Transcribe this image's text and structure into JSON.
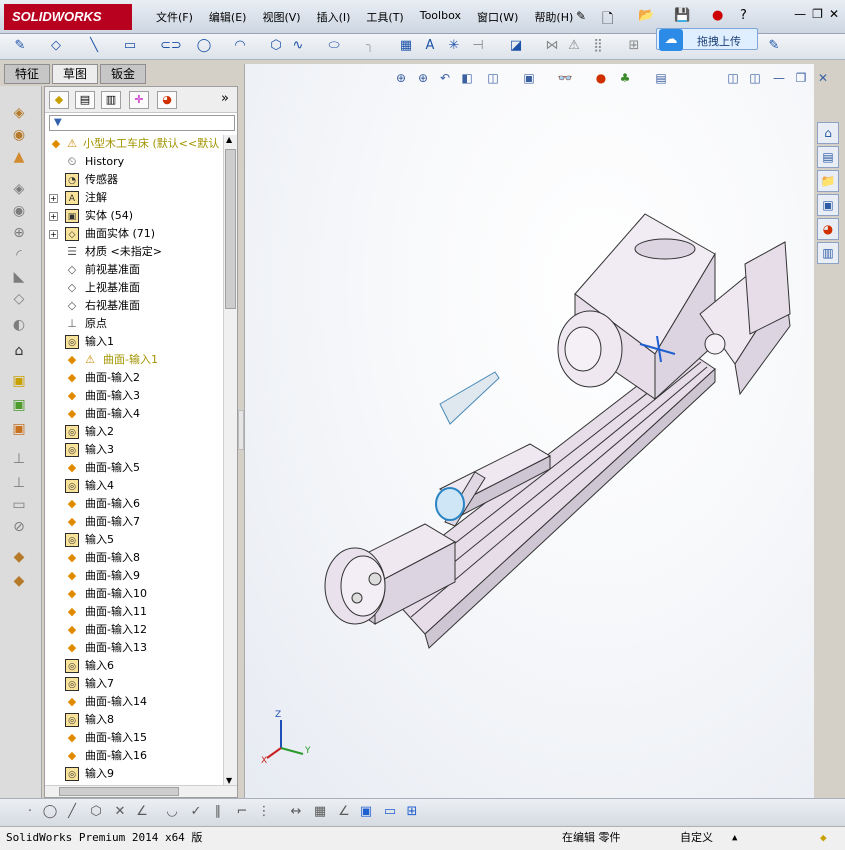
{
  "app": {
    "logo_text": "SOLIDWORKS",
    "menus": [
      "文件(F)",
      "编辑(E)",
      "视图(V)",
      "插入(I)",
      "工具(T)",
      "Toolbox",
      "窗口(W)",
      "帮助(H)"
    ],
    "window_controls": [
      "—",
      "❐",
      "✕"
    ]
  },
  "upload_tip": {
    "label": "拖拽上传"
  },
  "tabs": [
    "特征",
    "草图",
    "钣金"
  ],
  "active_tab": "草图",
  "tree": {
    "items": [
      {
        "label": "小型木工车床  (默认<<默认",
        "type": "root",
        "warning": true
      },
      {
        "label": "History",
        "type": "history"
      },
      {
        "label": "传感器",
        "type": "sensor"
      },
      {
        "label": "注解",
        "type": "annotation",
        "expandable": true
      },
      {
        "label": "实体 (54)",
        "type": "solid",
        "expandable": true
      },
      {
        "label": "曲面实体 (71)",
        "type": "surface-body",
        "expandable": true
      },
      {
        "label": "材质 <未指定>",
        "type": "material"
      },
      {
        "label": "前视基准面",
        "type": "plane"
      },
      {
        "label": "上视基准面",
        "type": "plane"
      },
      {
        "label": "右视基准面",
        "type": "plane"
      },
      {
        "label": "原点",
        "type": "origin"
      },
      {
        "label": "输入1",
        "type": "import"
      },
      {
        "label": "曲面-输入1",
        "type": "surface",
        "warning": true
      },
      {
        "label": "曲面-输入2",
        "type": "surface"
      },
      {
        "label": "曲面-输入3",
        "type": "surface"
      },
      {
        "label": "曲面-输入4",
        "type": "surface"
      },
      {
        "label": "输入2",
        "type": "import"
      },
      {
        "label": "输入3",
        "type": "import"
      },
      {
        "label": "曲面-输入5",
        "type": "surface"
      },
      {
        "label": "输入4",
        "type": "import"
      },
      {
        "label": "曲面-输入6",
        "type": "surface"
      },
      {
        "label": "曲面-输入7",
        "type": "surface"
      },
      {
        "label": "输入5",
        "type": "import"
      },
      {
        "label": "曲面-输入8",
        "type": "surface"
      },
      {
        "label": "曲面-输入9",
        "type": "surface"
      },
      {
        "label": "曲面-输入10",
        "type": "surface"
      },
      {
        "label": "曲面-输入11",
        "type": "surface"
      },
      {
        "label": "曲面-输入12",
        "type": "surface"
      },
      {
        "label": "曲面-输入13",
        "type": "surface"
      },
      {
        "label": "输入6",
        "type": "import"
      },
      {
        "label": "输入7",
        "type": "import"
      },
      {
        "label": "曲面-输入14",
        "type": "surface"
      },
      {
        "label": "输入8",
        "type": "import"
      },
      {
        "label": "曲面-输入15",
        "type": "surface"
      },
      {
        "label": "曲面-输入16",
        "type": "surface"
      },
      {
        "label": "输入9",
        "type": "import"
      }
    ]
  },
  "status": {
    "version": "SolidWorks Premium 2014 x64 版",
    "edit_mode": "在编辑 零件",
    "units": "自定义"
  },
  "colors": {
    "logo_red": "#b8001f",
    "accent_blue": "#2b8be6",
    "warning_yellow": "#a39400",
    "model_fill": "#e8e0ea"
  }
}
